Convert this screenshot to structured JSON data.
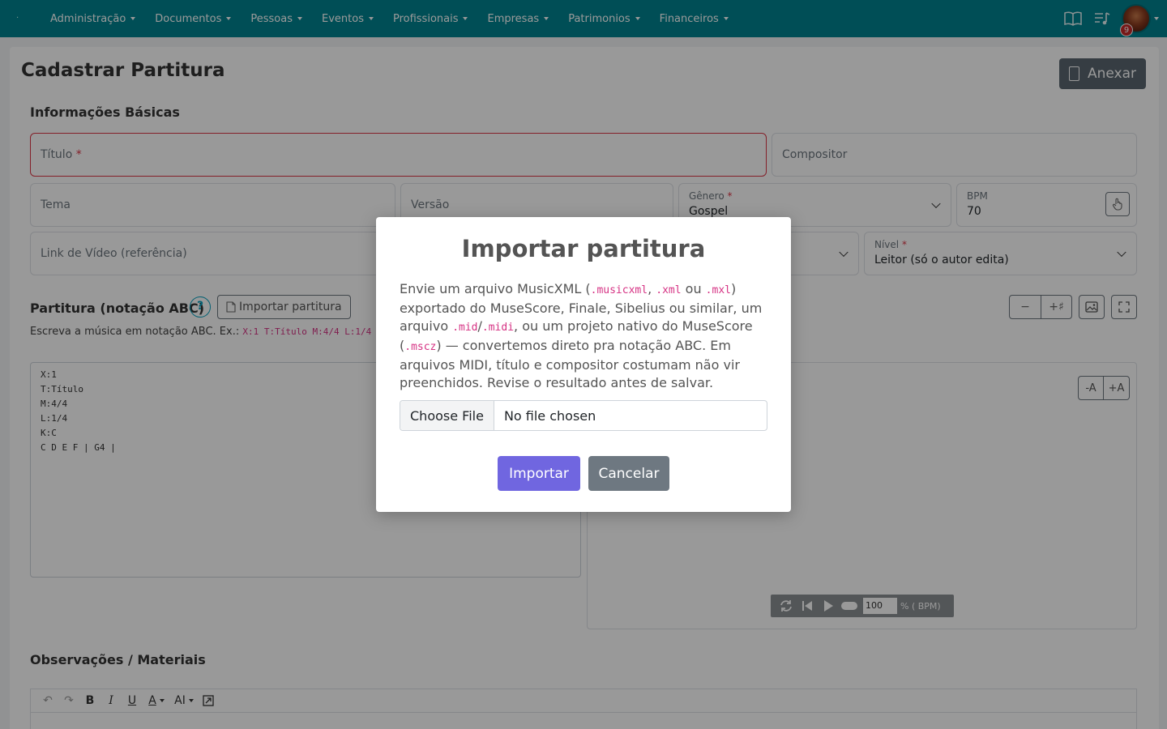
{
  "navbar": {
    "brand": "·",
    "menus": [
      "Administração",
      "Documentos",
      "Pessoas",
      "Eventos",
      "Profissionais",
      "Empresas",
      "Patrimonios",
      "Financeiros"
    ],
    "notifications_count": "9"
  },
  "page": {
    "title": "Cadastrar Partitura",
    "attach_button": "Anexar",
    "basic_section": "Informações Básicas",
    "fields": {
      "titulo_label": "Título",
      "compositor": "Compositor",
      "tema": "Tema",
      "versao": "Versão",
      "genero_label": "Gênero",
      "genero_value": "Gospel",
      "bpm_label": "BPM",
      "bpm_value": "70",
      "link_video": "Link de Vídeo (referência)",
      "nivel_label": "Nível",
      "nivel_value": "Leitor (só o autor edita)"
    },
    "required_mark": "*",
    "score_section": "Partitura (notação ABC)",
    "help_label": "?",
    "import_button": "Importar partitura",
    "hint_text": "Escreva a música em notação ABC. Ex.:",
    "hint_code": "X:1 T:Título M:4/4 L:1/4",
    "transpose_minus": "−",
    "transpose_plus": "+♯",
    "abc_lines": [
      "X:1",
      "T:Título",
      "M:4/4",
      "L:1/4",
      "K:C",
      "C D E F | G4 |"
    ],
    "zoom_minus": "-A",
    "zoom_plus": "+A",
    "player_tempo": "100",
    "player_unit": "% ( BPM)",
    "notes_section": "Observações / Materiais"
  },
  "modal": {
    "title": "Importar partitura",
    "text_parts": {
      "p1": "Envie um arquivo MusicXML (",
      "c1": ".musicxml",
      "p2": ", ",
      "c2": ".xml",
      "p3": " ou ",
      "c3": ".mxl",
      "p4": ") exportado do MuseScore, Finale, Sibelius ou similar, um arquivo ",
      "c4": ".mid",
      "p5": "/",
      "c5": ".midi",
      "p6": ", ou um projeto nativo do MuseScore (",
      "c6": ".mscz",
      "p7": ") — convertemos direto pra notação ABC. Em arquivos MIDI, título e compositor costumam não vir preenchidos. Revise o resultado antes de salvar."
    },
    "file_button": "Choose File",
    "file_status": "No file chosen",
    "confirm": "Importar",
    "cancel": "Cancelar"
  },
  "colors": {
    "navbar": "#00838f",
    "confirm": "#7066e0",
    "cancel": "#6e7881",
    "required": "#dc3545"
  }
}
